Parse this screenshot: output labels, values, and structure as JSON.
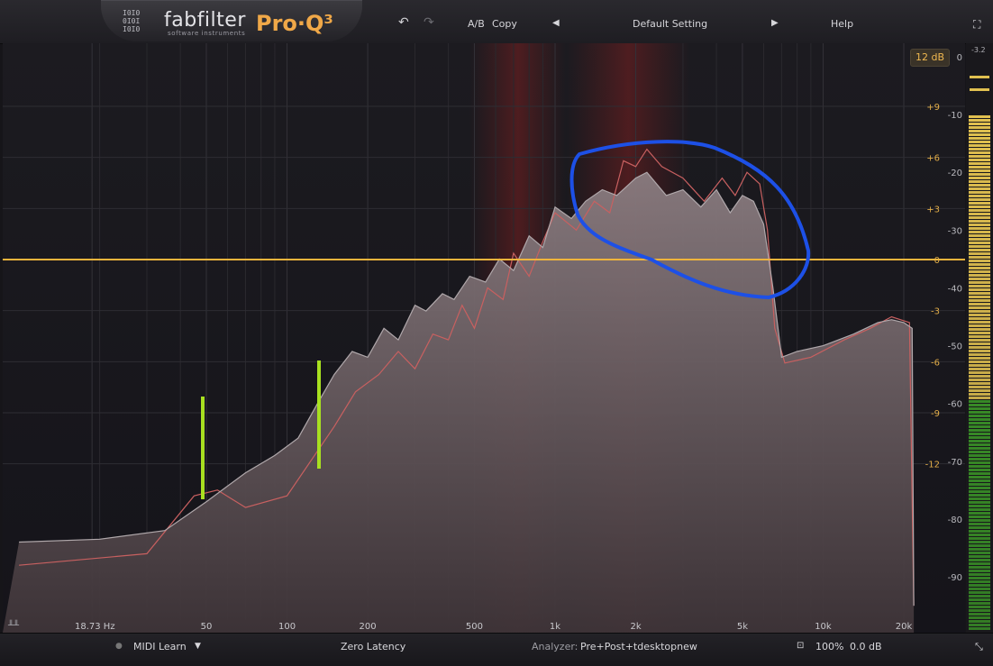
{
  "header": {
    "brand": "fabfilter",
    "brand_sub": "software instruments",
    "product": "Pro·Q³",
    "ab_label": "A/B",
    "copy_label": "Copy",
    "preset": "Default Setting",
    "help_label": "Help"
  },
  "range_button": "12 dB",
  "freq_labels": [
    {
      "label": "18.73 Hz",
      "hz": 18.73
    },
    {
      "label": "50",
      "hz": 50
    },
    {
      "label": "100",
      "hz": 100
    },
    {
      "label": "200",
      "hz": 200
    },
    {
      "label": "500",
      "hz": 500
    },
    {
      "label": "1k",
      "hz": 1000
    },
    {
      "label": "2k",
      "hz": 2000
    },
    {
      "label": "5k",
      "hz": 5000
    },
    {
      "label": "10k",
      "hz": 10000
    },
    {
      "label": "20k",
      "hz": 20000
    }
  ],
  "eq_db_labels": [
    "+9",
    "+6",
    "+3",
    "0",
    "-3",
    "-6",
    "-9",
    "-12"
  ],
  "eq_db_values": [
    9,
    6,
    3,
    0,
    -3,
    -6,
    -9,
    -12
  ],
  "analyzer_db_labels": [
    "0",
    "-10",
    "-20",
    "-30",
    "-40",
    "-50",
    "-60",
    "-70",
    "-80",
    "-90"
  ],
  "analyzer_db_values": [
    0,
    -10,
    -20,
    -30,
    -40,
    -50,
    -60,
    -70,
    -80,
    -90
  ],
  "meter": {
    "peak_label": "-3.2"
  },
  "colors": {
    "eq_line": "#f0b43c",
    "spectrum_fill": "#7c6e72",
    "spectrum_line_post": "#b0a8ab",
    "spectrum_line_pre": "#c86060",
    "annotation_circle": "#1d50e6",
    "annotation_marks": "#a8e020",
    "meter_green": "#3c9c28",
    "meter_yellow": "#e0c050"
  },
  "footer": {
    "midi_learn": "MIDI Learn",
    "latency": "Zero Latency",
    "analyzer_label": "Analyzer:",
    "analyzer_value": "Pre+Post+tdesktopnew",
    "zoom": "100%",
    "output_gain": "0.0 dB"
  }
}
